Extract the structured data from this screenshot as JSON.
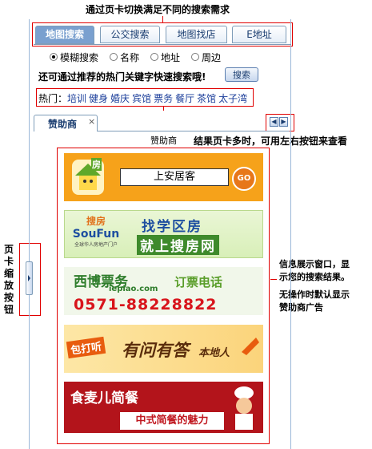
{
  "annotations": {
    "top": "通过页卡切换满足不同的搜索需求",
    "sponsor_small": "赞助商",
    "results_note": "结果页卡多时，可用左右按钮来查看",
    "left_vertical": [
      "页",
      "卡",
      "缩",
      "放",
      "按",
      "钮"
    ],
    "right_info_1": "信息展示窗口，显",
    "right_info_2": "示您的搜索结果。",
    "right_info_3": "无操作时默认显示",
    "right_info_4": "赞助商广告"
  },
  "tabs": [
    "地图搜索",
    "公交搜索",
    "地图找店",
    "E地址"
  ],
  "radios": [
    {
      "label": "模糊搜索",
      "checked": true
    },
    {
      "label": "名称",
      "checked": false
    },
    {
      "label": "地址",
      "checked": false
    },
    {
      "label": "周边",
      "checked": false
    }
  ],
  "hint": "还可通过推荐的热门关键字快速搜索哦!",
  "search_button": "搜索",
  "hot": {
    "label": "热门：",
    "keywords": [
      "培训",
      "健身",
      "婚庆",
      "宾馆",
      "票务",
      "餐厅",
      "茶馆",
      "太子湾"
    ]
  },
  "result_tab": {
    "label": "赞助商",
    "close": "×"
  },
  "nav": {
    "left": "◀",
    "right": "▶"
  },
  "ads": [
    {
      "badge": "房",
      "text": "上安居客",
      "go": "GO"
    },
    {
      "logo_top": "搜房",
      "logo_en": "SouFun",
      "logo_sub": "全球华人房地产门户",
      "line1": "找学区房",
      "line2": "就上搜房网"
    },
    {
      "brand": "西博票务",
      "domain": "iepiao.com",
      "line1": "订票电话",
      "phone": "0571-88228822"
    },
    {
      "left": "包打听",
      "main": "有问有答",
      "tail": "本地人"
    },
    {
      "title": "食麦儿简餐",
      "slogan": "中式简餐的魅力"
    }
  ],
  "colors": {
    "annotation": "#e00000",
    "tab_active": "#7aa0cf",
    "tab_border": "#7f9db9",
    "link": "#1a3d9a"
  }
}
